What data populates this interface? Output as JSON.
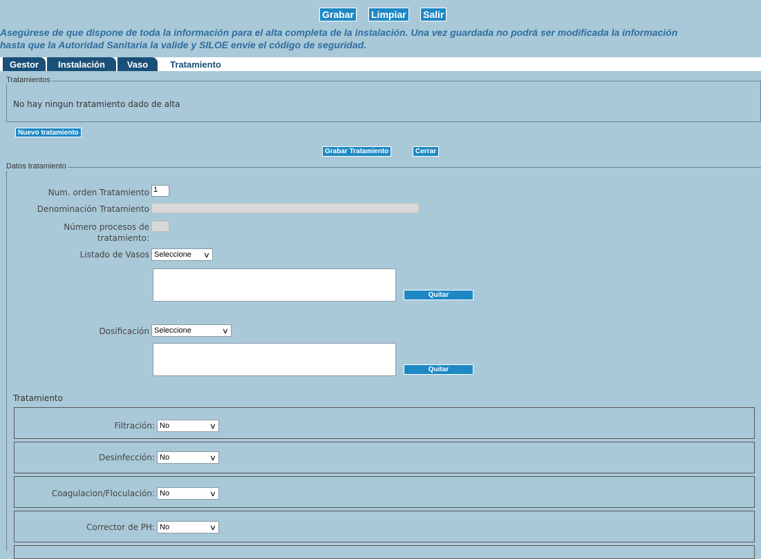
{
  "toolbar": {
    "grabar": "Grabar",
    "limpiar": "Limpiar",
    "salir": "Salir"
  },
  "notice": {
    "line1": "Asegúrese de que dispone de toda la información para el alta completa de la instalación. Una vez guardada no podrá ser modificada la información",
    "line2": "hasta que la Autoridad Sanitaria la valide y SILOE envíe el código de seguridad."
  },
  "tabs": [
    {
      "label": "Gestor"
    },
    {
      "label": "Instalación"
    },
    {
      "label": "Vaso"
    },
    {
      "label": "Tratamiento"
    }
  ],
  "tratamientos": {
    "legend": "Tratamientos",
    "empty_message": "No hay ningun tratamiento dado de alta",
    "nuevo_button": "Nuevo tratamiento"
  },
  "actions": {
    "grabar_tratamiento": "Grabar Tratamiento",
    "cerrar": "Cerrar"
  },
  "datos": {
    "legend": "Datos tratamiento",
    "num_orden_label": "Num. orden Tratamiento",
    "num_orden_value": "1",
    "denominacion_label": "Denominación Tratamiento",
    "denominacion_value": "",
    "num_procesos_label_1": "Número procesos de",
    "num_procesos_label_2": "tratamiento:",
    "num_procesos_value": "",
    "vasos_label": "Listado de Vasos",
    "vasos_selected": "Seleccione",
    "quitar_1": "Quitar",
    "dosificacion_label": "Dosificación",
    "dosificacion_selected": "Seleccione",
    "quitar_2": "Quitar"
  },
  "tratamiento_section": {
    "heading": "Tratamiento",
    "rows": [
      {
        "label": "Filtración:",
        "value": "No"
      },
      {
        "label": "Desinfección:",
        "value": "No"
      },
      {
        "label": "Coagulacion/Floculación:",
        "value": "No"
      },
      {
        "label": "Corrector de PH:",
        "value": "No"
      }
    ]
  }
}
